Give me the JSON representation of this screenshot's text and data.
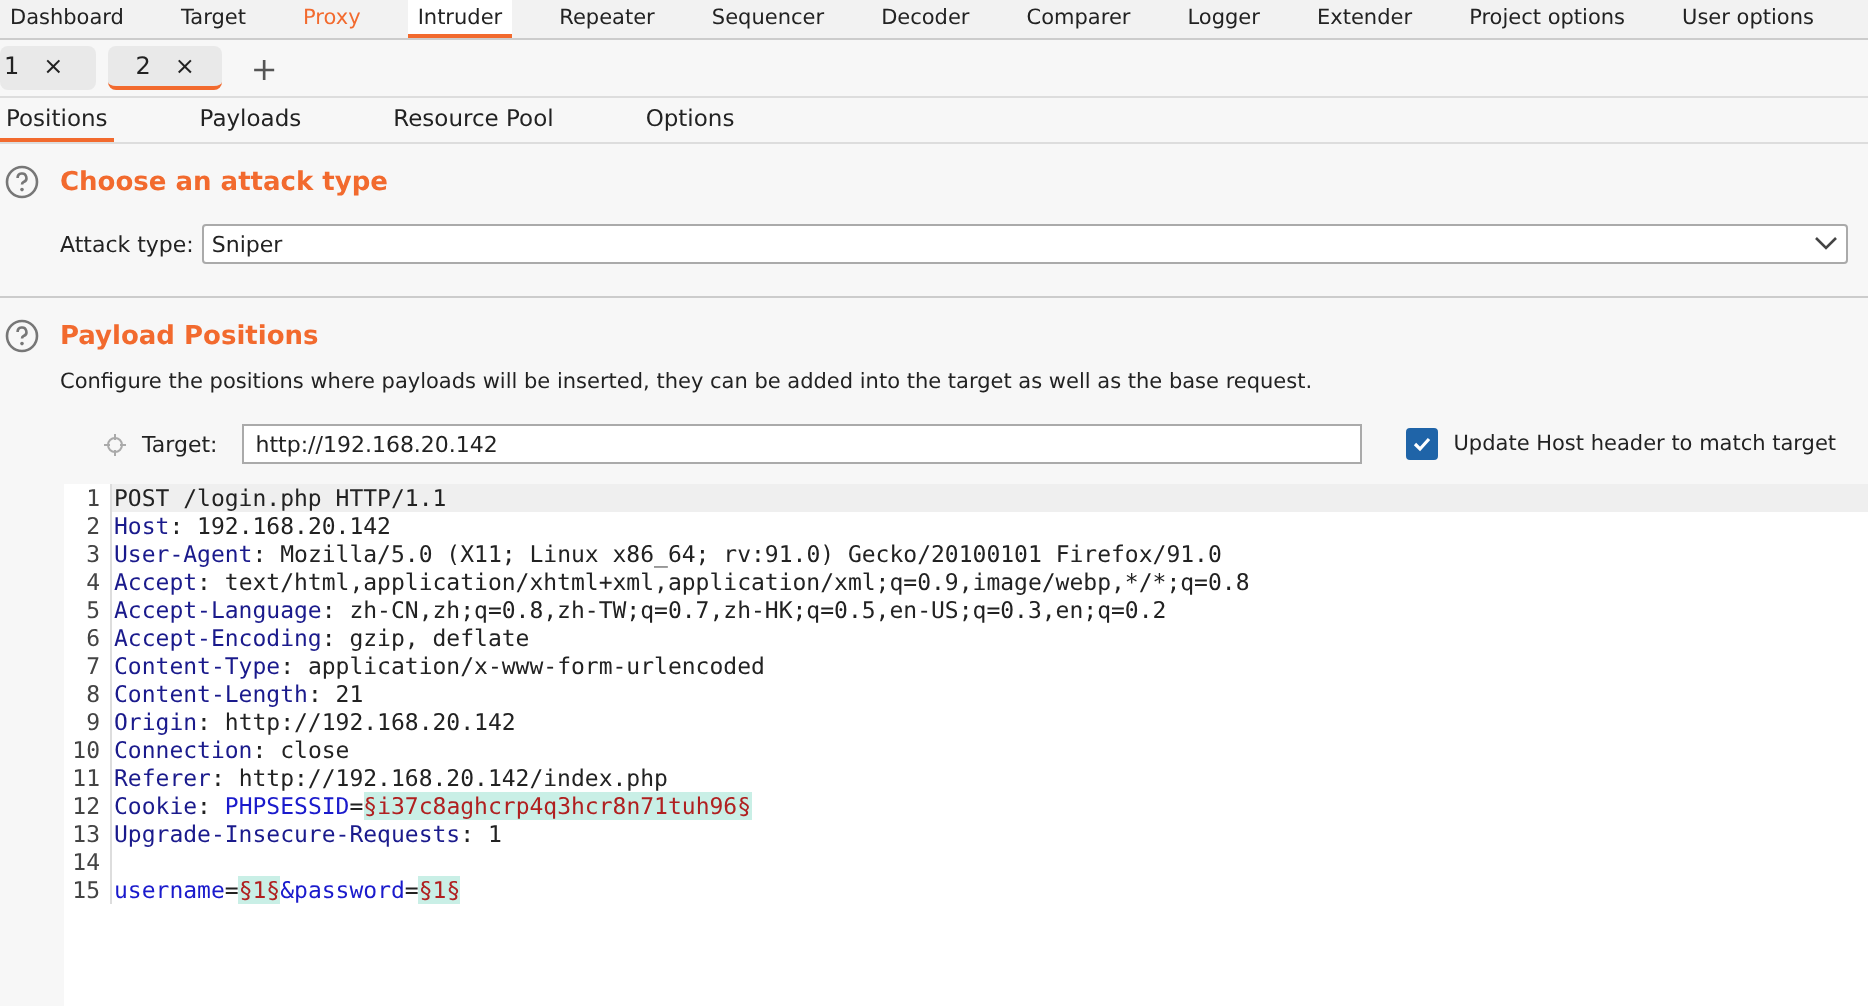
{
  "main_tabs": [
    {
      "label": "Dashboard",
      "selected": false,
      "highlighted": false
    },
    {
      "label": "Target",
      "selected": false,
      "highlighted": false
    },
    {
      "label": "Proxy",
      "selected": false,
      "highlighted": true
    },
    {
      "label": "Intruder",
      "selected": true,
      "highlighted": false
    },
    {
      "label": "Repeater",
      "selected": false,
      "highlighted": false
    },
    {
      "label": "Sequencer",
      "selected": false,
      "highlighted": false
    },
    {
      "label": "Decoder",
      "selected": false,
      "highlighted": false
    },
    {
      "label": "Comparer",
      "selected": false,
      "highlighted": false
    },
    {
      "label": "Logger",
      "selected": false,
      "highlighted": false
    },
    {
      "label": "Extender",
      "selected": false,
      "highlighted": false
    },
    {
      "label": "Project options",
      "selected": false,
      "highlighted": false
    },
    {
      "label": "User options",
      "selected": false,
      "highlighted": false
    }
  ],
  "attack_tabs": [
    {
      "label": "1",
      "close": "×",
      "selected": false
    },
    {
      "label": "2",
      "close": "×",
      "selected": true
    }
  ],
  "add_tab": "+",
  "sub_tabs": [
    {
      "label": "Positions",
      "selected": true
    },
    {
      "label": "Payloads",
      "selected": false
    },
    {
      "label": "Resource Pool",
      "selected": false
    },
    {
      "label": "Options",
      "selected": false
    }
  ],
  "attack_section": {
    "title": "Choose an attack type",
    "field_label": "Attack type:",
    "value": "Sniper"
  },
  "positions_section": {
    "title": "Payload Positions",
    "description": "Configure the positions where payloads will be inserted, they can be added into the target as well as the base request.",
    "target_label": "Target:",
    "target_value": "http://192.168.20.142",
    "update_host": {
      "label": "Update Host header to match target",
      "checked": true
    }
  },
  "request_lines": [
    {
      "number": "1",
      "current": true,
      "segments": [
        {
          "kind": "text",
          "text": "POST /login.php HTTP/1.1"
        }
      ]
    },
    {
      "number": "2",
      "current": false,
      "segments": [
        {
          "kind": "name",
          "text": "Host"
        },
        {
          "kind": "text",
          "text": ": 192.168.20.142"
        }
      ]
    },
    {
      "number": "3",
      "current": false,
      "segments": [
        {
          "kind": "name",
          "text": "User-Agent"
        },
        {
          "kind": "text",
          "text": ": Mozilla/5.0 (X11; Linux x86_64; rv:91.0) Gecko/20100101 Firefox/91.0"
        }
      ]
    },
    {
      "number": "4",
      "current": false,
      "segments": [
        {
          "kind": "name",
          "text": "Accept"
        },
        {
          "kind": "text",
          "text": ": text/html,application/xhtml+xml,application/xml;q=0.9,image/webp,*/*;q=0.8"
        }
      ]
    },
    {
      "number": "5",
      "current": false,
      "segments": [
        {
          "kind": "name",
          "text": "Accept-Language"
        },
        {
          "kind": "text",
          "text": ": zh-CN,zh;q=0.8,zh-TW;q=0.7,zh-HK;q=0.5,en-US;q=0.3,en;q=0.2"
        }
      ]
    },
    {
      "number": "6",
      "current": false,
      "segments": [
        {
          "kind": "name",
          "text": "Accept-Encoding"
        },
        {
          "kind": "text",
          "text": ": gzip, deflate"
        }
      ]
    },
    {
      "number": "7",
      "current": false,
      "segments": [
        {
          "kind": "name",
          "text": "Content-Type"
        },
        {
          "kind": "text",
          "text": ": application/x-www-form-urlencoded"
        }
      ]
    },
    {
      "number": "8",
      "current": false,
      "segments": [
        {
          "kind": "name",
          "text": "Content-Length"
        },
        {
          "kind": "text",
          "text": ": 21"
        }
      ]
    },
    {
      "number": "9",
      "current": false,
      "segments": [
        {
          "kind": "name",
          "text": "Origin"
        },
        {
          "kind": "text",
          "text": ": http://192.168.20.142"
        }
      ]
    },
    {
      "number": "10",
      "current": false,
      "segments": [
        {
          "kind": "name",
          "text": "Connection"
        },
        {
          "kind": "text",
          "text": ": close"
        }
      ]
    },
    {
      "number": "11",
      "current": false,
      "segments": [
        {
          "kind": "name",
          "text": "Referer"
        },
        {
          "kind": "text",
          "text": ": http://192.168.20.142/index.php"
        }
      ]
    },
    {
      "number": "12",
      "current": false,
      "segments": [
        {
          "kind": "name",
          "text": "Cookie"
        },
        {
          "kind": "text",
          "text": ": "
        },
        {
          "kind": "param",
          "text": "PHPSESSID"
        },
        {
          "kind": "text",
          "text": "="
        },
        {
          "kind": "payload",
          "text": "§i37c8aghcrp4q3hcr8n71tuh96§"
        }
      ]
    },
    {
      "number": "13",
      "current": false,
      "segments": [
        {
          "kind": "name",
          "text": "Upgrade-Insecure-Requests"
        },
        {
          "kind": "text",
          "text": ": 1"
        }
      ]
    },
    {
      "number": "14",
      "current": false
    },
    {
      "number": "15",
      "current": false,
      "segments": [
        {
          "kind": "param",
          "text": "username"
        },
        {
          "kind": "text",
          "text": "="
        },
        {
          "kind": "payload",
          "text": "§1§"
        },
        {
          "kind": "param",
          "text": "&password"
        },
        {
          "kind": "text",
          "text": "="
        },
        {
          "kind": "payload",
          "text": "§1§"
        }
      ]
    }
  ]
}
